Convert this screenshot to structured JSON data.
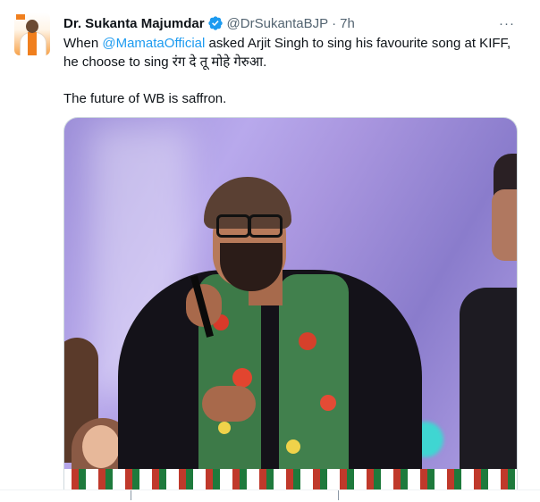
{
  "tweet": {
    "author": {
      "name": "Dr. Sukanta Majumdar",
      "handle": "@DrSukantaBJP",
      "separator": "·",
      "time": "7h"
    },
    "more_label": "···",
    "text": {
      "when": "When ",
      "mention": "@MamataOfficial",
      "line1_rest": " asked Arjit Singh to sing his favourite song at KIFF,",
      "line2": "he choose to sing रंग दे तू मोहे गेरुआ.",
      "line3": "The future of WB is saffron."
    }
  },
  "colors": {
    "accent": "#1d9bf0",
    "text": "#0f1419",
    "muted": "#536471",
    "border": "#cfd9de"
  },
  "icons": {
    "verified": "verified-badge-icon",
    "more": "more-options-icon"
  }
}
